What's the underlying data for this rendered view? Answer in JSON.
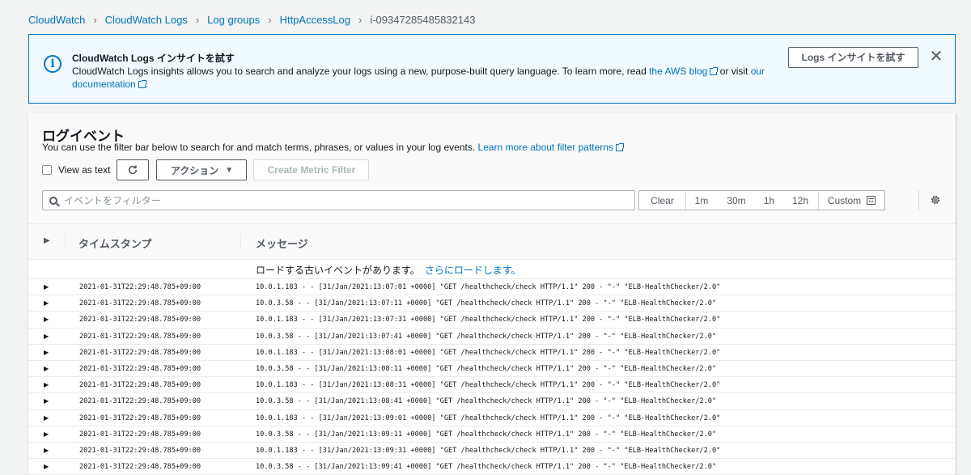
{
  "breadcrumb": {
    "items": [
      "CloudWatch",
      "CloudWatch Logs",
      "Log groups",
      "HttpAccessLog"
    ],
    "current": "i-09347285485832143"
  },
  "banner": {
    "title": "CloudWatch Logs インサイトを試す",
    "text_before": "CloudWatch Logs insights allows you to search and analyze your logs using a new, purpose-built query language. To learn more, read ",
    "link_blog": "the AWS blog",
    "text_mid": " or visit ",
    "link_docs": "our documentation",
    "text_end": ".",
    "try_button": "Logs インサイトを試す"
  },
  "panel": {
    "title": "ログイベント",
    "description": "You can use the filter bar below to search for and match terms, phrases, or values in your log events. ",
    "description_link": "Learn more about filter patterns",
    "view_as_text": "View as text",
    "actions_button": "アクション",
    "create_metric_filter": "Create Metric Filter",
    "search_placeholder": "イベントをフィルター",
    "range": {
      "clear": "Clear",
      "m1": "1m",
      "m30": "30m",
      "h1": "1h",
      "h12": "12h",
      "custom": "Custom"
    }
  },
  "table": {
    "col_timestamp": "タイムスタンプ",
    "col_message": "メッセージ",
    "load_text": "ロードする古いイベントがあります。",
    "load_link": "さらにロードします。",
    "rows": [
      {
        "ts": "2021-01-31T22:29:48.785+09:00",
        "msg": "10.0.1.183 - - [31/Jan/2021:13:07:01 +0000] \"GET /healthcheck/check HTTP/1.1\" 200 - \"-\" \"ELB-HealthChecker/2.0\""
      },
      {
        "ts": "2021-01-31T22:29:48.785+09:00",
        "msg": "10.0.3.58 - - [31/Jan/2021:13:07:11 +0000] \"GET /healthcheck/check HTTP/1.1\" 200 - \"-\" \"ELB-HealthChecker/2.0\""
      },
      {
        "ts": "2021-01-31T22:29:48.785+09:00",
        "msg": "10.0.1.183 - - [31/Jan/2021:13:07:31 +0000] \"GET /healthcheck/check HTTP/1.1\" 200 - \"-\" \"ELB-HealthChecker/2.0\""
      },
      {
        "ts": "2021-01-31T22:29:48.785+09:00",
        "msg": "10.0.3.58 - - [31/Jan/2021:13:07:41 +0000] \"GET /healthcheck/check HTTP/1.1\" 200 - \"-\" \"ELB-HealthChecker/2.0\""
      },
      {
        "ts": "2021-01-31T22:29:48.785+09:00",
        "msg": "10.0.1.183 - - [31/Jan/2021:13:08:01 +0000] \"GET /healthcheck/check HTTP/1.1\" 200 - \"-\" \"ELB-HealthChecker/2.0\""
      },
      {
        "ts": "2021-01-31T22:29:48.785+09:00",
        "msg": "10.0.3.58 - - [31/Jan/2021:13:08:11 +0000] \"GET /healthcheck/check HTTP/1.1\" 200 - \"-\" \"ELB-HealthChecker/2.0\""
      },
      {
        "ts": "2021-01-31T22:29:48.785+09:00",
        "msg": "10.0.1.183 - - [31/Jan/2021:13:08:31 +0000] \"GET /healthcheck/check HTTP/1.1\" 200 - \"-\" \"ELB-HealthChecker/2.0\""
      },
      {
        "ts": "2021-01-31T22:29:48.785+09:00",
        "msg": "10.0.3.58 - - [31/Jan/2021:13:08:41 +0000] \"GET /healthcheck/check HTTP/1.1\" 200 - \"-\" \"ELB-HealthChecker/2.0\""
      },
      {
        "ts": "2021-01-31T22:29:48.785+09:00",
        "msg": "10.0.1.183 - - [31/Jan/2021:13:09:01 +0000] \"GET /healthcheck/check HTTP/1.1\" 200 - \"-\" \"ELB-HealthChecker/2.0\""
      },
      {
        "ts": "2021-01-31T22:29:48.785+09:00",
        "msg": "10.0.3.58 - - [31/Jan/2021:13:09:11 +0000] \"GET /healthcheck/check HTTP/1.1\" 200 - \"-\" \"ELB-HealthChecker/2.0\""
      },
      {
        "ts": "2021-01-31T22:29:48.785+09:00",
        "msg": "10.0.1.183 - - [31/Jan/2021:13:09:31 +0000] \"GET /healthcheck/check HTTP/1.1\" 200 - \"-\" \"ELB-HealthChecker/2.0\""
      },
      {
        "ts": "2021-01-31T22:29:48.785+09:00",
        "msg": "10.0.3.58 - - [31/Jan/2021:13:09:41 +0000] \"GET /healthcheck/check HTTP/1.1\" 200 - \"-\" \"ELB-HealthChecker/2.0\""
      }
    ]
  },
  "icons": {
    "info": "info-icon",
    "close": "close-icon",
    "refresh": "refresh-icon",
    "search": "search-icon",
    "calendar": "calendar-icon",
    "gear": "gear-icon",
    "expand": "expand-caret-icon",
    "external": "external-link-icon"
  },
  "colors": {
    "link": "#0073bb",
    "banner_bg": "#f1faff",
    "banner_border": "#0073bb",
    "page_bg": "#f2f3f3"
  }
}
